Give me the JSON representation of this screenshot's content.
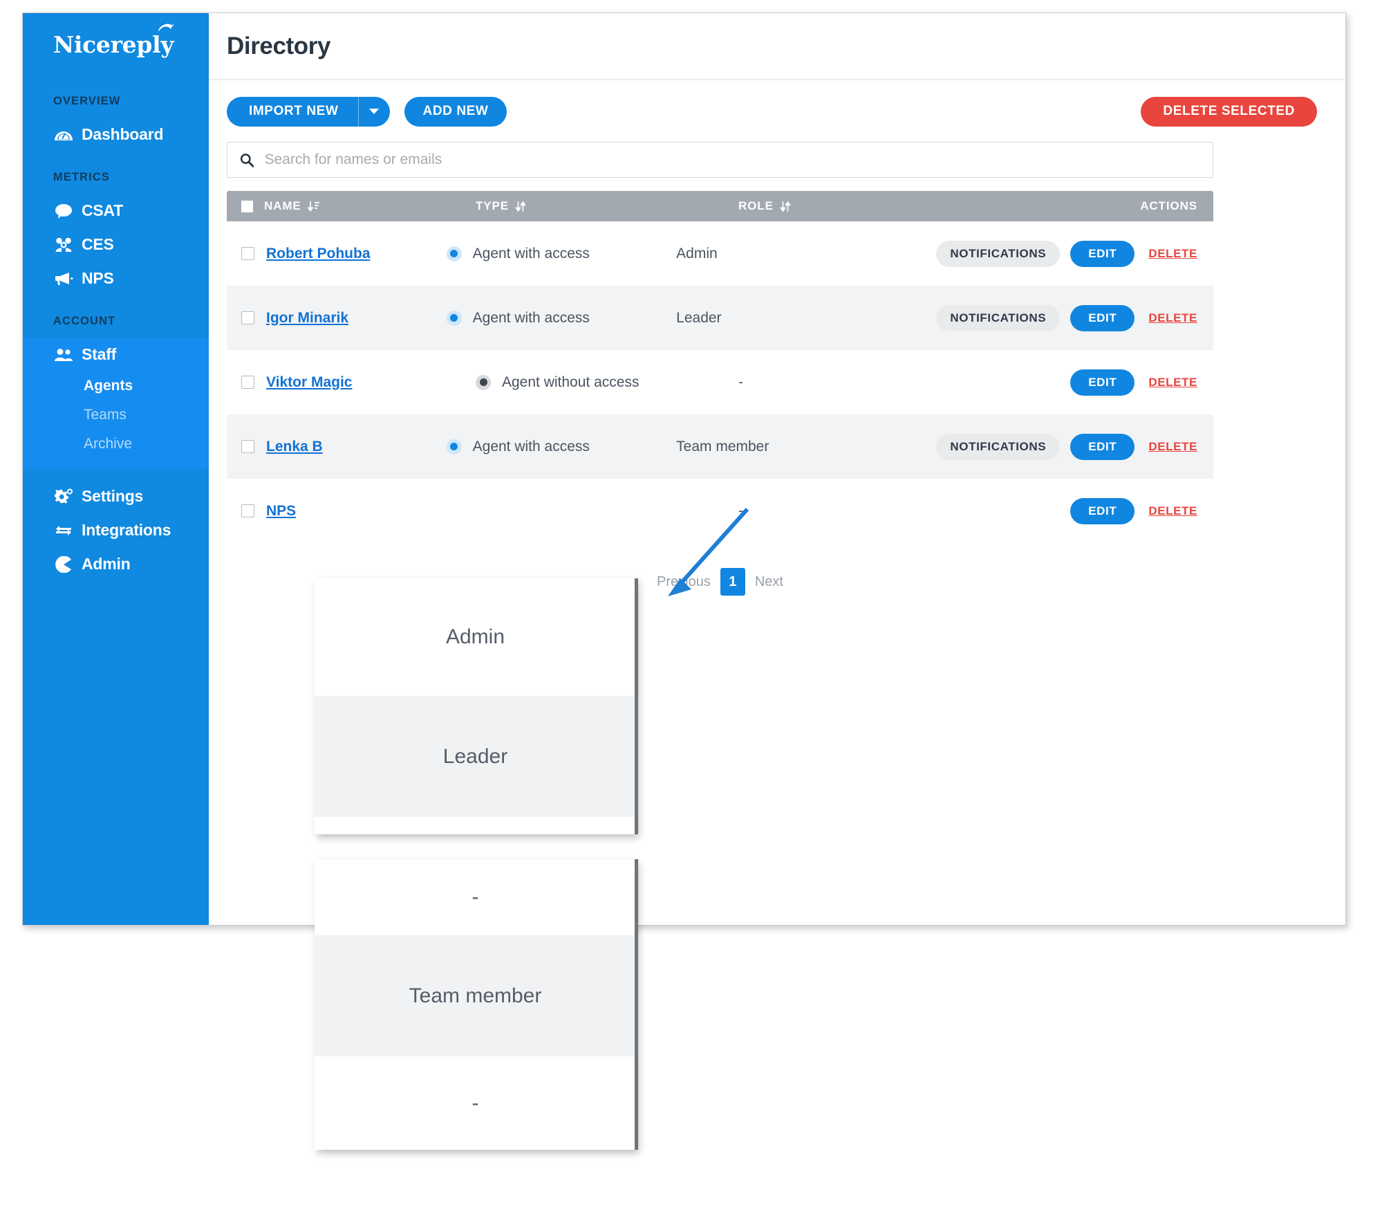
{
  "brand": {
    "name": "Nicereply",
    "primary": "#1086e0",
    "danger": "#e8453e",
    "sidebar_bg": "#1089e0",
    "header_row_bg": "#a2a9b1"
  },
  "sidebar": {
    "sections": [
      {
        "label": "OVERVIEW",
        "items": [
          {
            "label": "Dashboard",
            "icon": "dashboard-gauge-icon"
          }
        ]
      },
      {
        "label": "METRICS",
        "items": [
          {
            "label": "CSAT",
            "icon": "speech-bubble-icon"
          },
          {
            "label": "CES",
            "icon": "gear-people-icon"
          },
          {
            "label": "NPS",
            "icon": "megaphone-icon"
          }
        ]
      },
      {
        "label": "ACCOUNT",
        "items": [
          {
            "label": "Staff",
            "icon": "users-icon",
            "active": true
          }
        ]
      }
    ],
    "staff_sub_items": [
      {
        "label": "Agents",
        "active": true
      },
      {
        "label": "Teams",
        "active": false
      },
      {
        "label": "Archive",
        "active": false
      }
    ],
    "bottom_items": [
      {
        "label": "Settings",
        "icon": "gear-icon"
      },
      {
        "label": "Integrations",
        "icon": "exchange-arrows-icon"
      },
      {
        "label": "Admin",
        "icon": "pacman-icon"
      }
    ]
  },
  "header": {
    "title": "Directory"
  },
  "toolbar": {
    "import_label": "IMPORT NEW",
    "import_caret": "chevron-down-icon",
    "add_label": "ADD NEW",
    "delete_selected_label": "DELETE SELECTED"
  },
  "search": {
    "placeholder": "Search for names or emails",
    "value": "",
    "icon": "search-icon"
  },
  "table": {
    "columns": [
      {
        "key": "name",
        "label": "NAME",
        "sort_icon": "sort-amount-desc-icon"
      },
      {
        "key": "type",
        "label": "TYPE",
        "sort_icon": "sort-updown-icon"
      },
      {
        "key": "role",
        "label": "ROLE",
        "sort_icon": "sort-updown-icon"
      },
      {
        "key": "actions",
        "label": "ACTIONS",
        "sort_icon": ""
      }
    ],
    "rows": [
      {
        "name": "Robert Pohuba",
        "type": "Agent with access",
        "access": true,
        "role": "Admin",
        "notifications": "NOTIFICATIONS",
        "edit": "EDIT",
        "delete": "DELETE",
        "has_notifications": true
      },
      {
        "name": "Igor Minarik",
        "type": "Agent with access",
        "access": true,
        "role": "Leader",
        "notifications": "NOTIFICATIONS",
        "edit": "EDIT",
        "delete": "DELETE",
        "has_notifications": true
      },
      {
        "name": "Viktor Magic",
        "type": "Agent without access",
        "access": false,
        "role": "-",
        "notifications": "",
        "edit": "EDIT",
        "delete": "DELETE",
        "has_notifications": false
      },
      {
        "name": "Lenka B",
        "type": "Agent with access",
        "access": true,
        "role": "Team member",
        "notifications": "NOTIFICATIONS",
        "edit": "EDIT",
        "delete": "DELETE",
        "has_notifications": true
      },
      {
        "name": "NPS",
        "type": "",
        "access": null,
        "role": "-",
        "notifications": "",
        "edit": "EDIT",
        "delete": "DELETE",
        "has_notifications": false
      }
    ]
  },
  "pagination": {
    "previous": "Previous",
    "current_page": "1",
    "next": "Next"
  },
  "callout": {
    "top_bands": [
      "Admin",
      "Leader"
    ],
    "bottom_bands": [
      "-",
      "Team member",
      "-"
    ],
    "annotation_arrow": "blue-arrow-pointing-to-role-column"
  }
}
